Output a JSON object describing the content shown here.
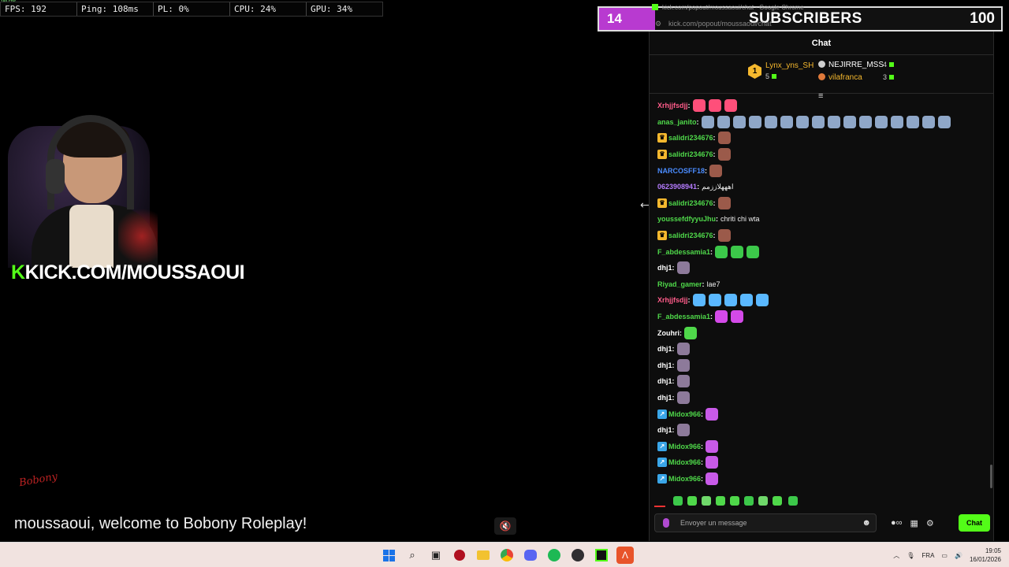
{
  "perf": {
    "tiny": "189 FPS",
    "fps": "FPS: 192",
    "ping": "Ping: 108ms",
    "pl": "PL: 0%",
    "cpu": "CPU: 24%",
    "gpu": "GPU: 34%"
  },
  "overlay": {
    "brand_k": "K",
    "brand_text": "KICK.COM/MOUSSAOUI",
    "small_logo": "Bobony",
    "welcome": "moussaoui, welcome to Bobony Roleplay!"
  },
  "subgoal": {
    "current": "14",
    "label": "SUBSCRIBERS",
    "goal": "100",
    "progress": 0.14,
    "fill_color": "#b83ad0"
  },
  "browser": {
    "title": "kick.com/popout/moussaoui/chat - Google Chrome",
    "url": "kick.com/popout/moussaoui/chat"
  },
  "chat": {
    "title": "Chat",
    "leaderboard": {
      "first": {
        "rank": "1",
        "name": "Lynx_yns_SH",
        "count": "5"
      },
      "others": [
        {
          "name": "NEJIRRE_MSS",
          "count": "4",
          "color": "#ffffff",
          "dot": "#cfcfcf"
        },
        {
          "name": "vilafranca",
          "count": "3",
          "color": "#f5b82e",
          "dot": "#e07a3a"
        }
      ]
    },
    "messages": [
      {
        "user": "Xrhjjfsdjj",
        "color": "#ff5c8a",
        "badge": "",
        "text": "",
        "emotes": [
          "#ff4f7a",
          "#ff4f7a",
          "#ff4f7a"
        ]
      },
      {
        "user": "anas_janito",
        "color": "#4fd84a",
        "badge": "",
        "text": "",
        "emotes": [
          "#8fa7c8",
          "#8fa7c8",
          "#8fa7c8",
          "#8fa7c8",
          "#8fa7c8",
          "#8fa7c8",
          "#8fa7c8",
          "#8fa7c8",
          "#8fa7c8",
          "#8fa7c8",
          "#8fa7c8",
          "#8fa7c8",
          "#8fa7c8",
          "#8fa7c8",
          "#8fa7c8",
          "#8fa7c8"
        ]
      },
      {
        "user": "salidri234676",
        "color": "#4fd84a",
        "badge": "crown",
        "text": "",
        "emotes": [
          "#9b5a4a"
        ]
      },
      {
        "user": "salidri234676",
        "color": "#4fd84a",
        "badge": "crown",
        "text": "",
        "emotes": [
          "#9b5a4a"
        ]
      },
      {
        "user": "NARCOSFF18",
        "color": "#4a8cff",
        "badge": "",
        "text": "",
        "emotes": [
          "#9b5a4a"
        ]
      },
      {
        "user": "0623908941",
        "color": "#b57cff",
        "badge": "",
        "text": "اهههلاززمم",
        "emotes": []
      },
      {
        "user": "salidri234676",
        "color": "#4fd84a",
        "badge": "crown",
        "text": "",
        "emotes": [
          "#9b5a4a"
        ]
      },
      {
        "user": "youssefdfyyuJhu",
        "color": "#4fd84a",
        "badge": "",
        "text": "chriti chi wta",
        "emotes": []
      },
      {
        "user": "salidri234676",
        "color": "#4fd84a",
        "badge": "crown",
        "text": "",
        "emotes": [
          "#9b5a4a"
        ]
      },
      {
        "user": "F_abdessamia1",
        "color": "#4fd84a",
        "badge": "",
        "text": "",
        "emotes": [
          "#3cc84a",
          "#3cc84a",
          "#3cc84a"
        ]
      },
      {
        "user": "dhj1",
        "color": "#ffffff",
        "badge": "",
        "text": "",
        "emotes": [
          "#8d7a9a"
        ]
      },
      {
        "user": "Riyad_gamer",
        "color": "#4fd84a",
        "badge": "",
        "text": "lae7",
        "emotes": []
      },
      {
        "user": "Xrhjjfsdjj",
        "color": "#ff5c8a",
        "badge": "",
        "text": "",
        "emotes": [
          "#5ab8ff",
          "#5ab8ff",
          "#5ab8ff",
          "#5ab8ff",
          "#5ab8ff"
        ]
      },
      {
        "user": "F_abdessamia1",
        "color": "#4fd84a",
        "badge": "",
        "text": "",
        "emotes": [
          "#d44ae8",
          "#d44ae8"
        ]
      },
      {
        "user": "Zouhri",
        "color": "#ffffff",
        "badge": "",
        "text": "",
        "emotes": [
          "#4fd84a"
        ]
      },
      {
        "user": "dhj1",
        "color": "#ffffff",
        "badge": "",
        "text": "",
        "emotes": [
          "#8d7a9a"
        ]
      },
      {
        "user": "dhj1",
        "color": "#ffffff",
        "badge": "",
        "text": "",
        "emotes": [
          "#8d7a9a"
        ]
      },
      {
        "user": "dhj1",
        "color": "#ffffff",
        "badge": "",
        "text": "",
        "emotes": [
          "#8d7a9a"
        ]
      },
      {
        "user": "dhj1",
        "color": "#ffffff",
        "badge": "",
        "text": "",
        "emotes": [
          "#8d7a9a"
        ]
      },
      {
        "user": "Midox966",
        "color": "#4fd84a",
        "badge": "bolt",
        "text": "",
        "emotes": [
          "#c85ae8"
        ]
      },
      {
        "user": "dhj1",
        "color": "#ffffff",
        "badge": "",
        "text": "",
        "emotes": [
          "#8d7a9a"
        ]
      },
      {
        "user": "Midox966",
        "color": "#4fd84a",
        "badge": "bolt",
        "text": "",
        "emotes": [
          "#c85ae8"
        ]
      },
      {
        "user": "Midox966",
        "color": "#4fd84a",
        "badge": "bolt",
        "text": "",
        "emotes": [
          "#c85ae8"
        ]
      },
      {
        "user": "Midox966",
        "color": "#4fd84a",
        "badge": "bolt",
        "text": "",
        "emotes": [
          "#c85ae8"
        ]
      }
    ],
    "input_placeholder": "Envoyer un message",
    "send_label": "Chat",
    "infinity": "∞"
  },
  "taskbar": {
    "language": "FRA",
    "time": "19:05",
    "date": "16/01/2026"
  }
}
